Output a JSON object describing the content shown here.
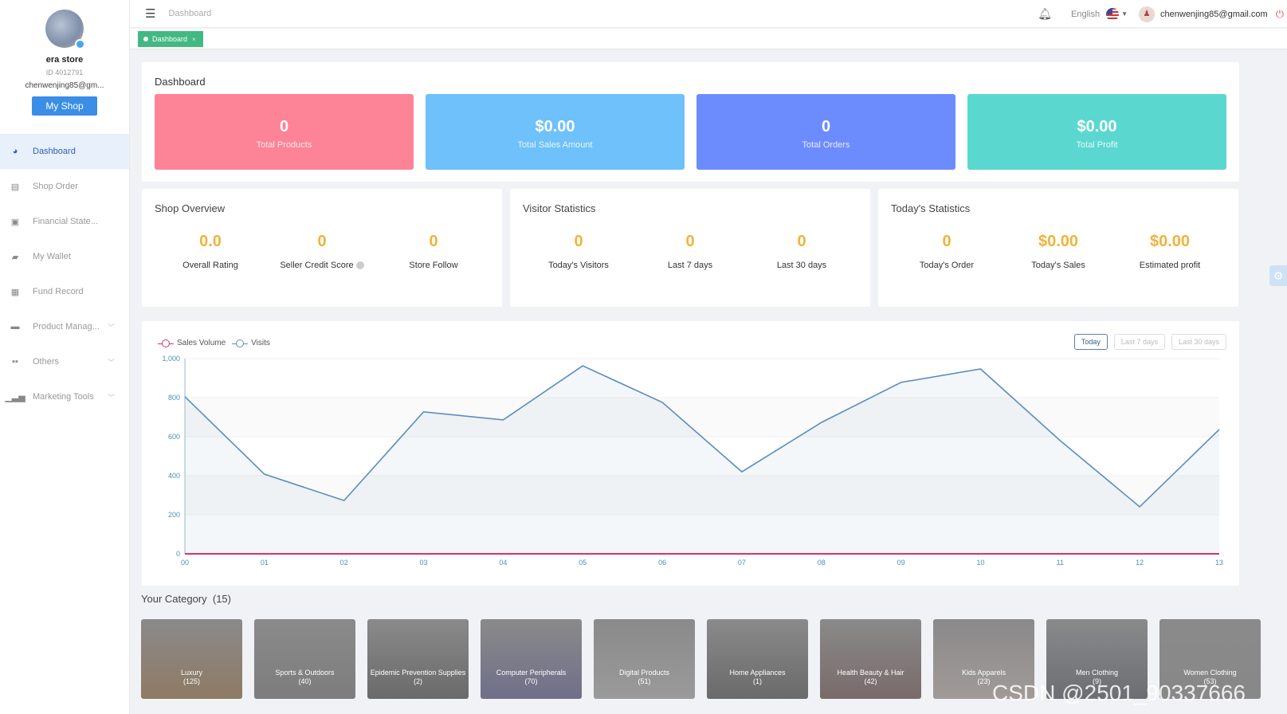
{
  "sidebar": {
    "store_name": "era store",
    "store_id": "ID 4012791",
    "email": "chenwenjing85@gm...",
    "my_shop": "My Shop",
    "items": [
      {
        "label": "Dashboard",
        "icon": "dashboard-icon",
        "active": true
      },
      {
        "label": "Shop Order",
        "icon": "clipboard-icon"
      },
      {
        "label": "Financial State...",
        "icon": "chart-box-icon"
      },
      {
        "label": "My Wallet",
        "icon": "wallet-icon"
      },
      {
        "label": "Fund Record",
        "icon": "document-icon"
      },
      {
        "label": "Product Manag...",
        "icon": "briefcase-icon",
        "expandable": true
      },
      {
        "label": "Others",
        "icon": "grid-icon",
        "expandable": true
      },
      {
        "label": "Marketing Tools",
        "icon": "bar-chart-icon",
        "expandable": true
      }
    ]
  },
  "topbar": {
    "breadcrumb": "Dashboard",
    "language": "English",
    "user_email": "chenwenjing85@gmail.com"
  },
  "tabs": [
    {
      "label": "Dashboard"
    }
  ],
  "dashboard": {
    "title": "Dashboard",
    "stats": [
      {
        "value": "0",
        "label": "Total Products",
        "color": "#fd8396"
      },
      {
        "value": "$0.00",
        "label": "Total Sales Amount",
        "color": "#6ec1fb"
      },
      {
        "value": "0",
        "label": "Total Orders",
        "color": "#6c8cfe"
      },
      {
        "value": "$0.00",
        "label": "Total Profit",
        "color": "#5ad8d0"
      }
    ]
  },
  "shop_overview": {
    "title": "Shop Overview",
    "metrics": [
      {
        "value": "0.0",
        "label": "Overall Rating"
      },
      {
        "value": "0",
        "label": "Seller Credit Score"
      },
      {
        "value": "0",
        "label": "Store Follow"
      }
    ]
  },
  "visitor_statistics": {
    "title": "Visitor Statistics",
    "metrics": [
      {
        "value": "0",
        "label": "Today's Visitors"
      },
      {
        "value": "0",
        "label": "Last 7 days"
      },
      {
        "value": "0",
        "label": "Last 30 days"
      }
    ]
  },
  "todays_statistics": {
    "title": "Today's Statistics",
    "metrics": [
      {
        "value": "0",
        "label": "Today's Order"
      },
      {
        "value": "$0.00",
        "label": "Today's Sales"
      },
      {
        "value": "$0.00",
        "label": "Estimated profit"
      }
    ]
  },
  "chart_controls": {
    "ranges": [
      "Today",
      "Last 7 days",
      "Last 30 days"
    ],
    "selected": "Today"
  },
  "chart_data": {
    "type": "line",
    "title": "",
    "xlabel": "",
    "ylabel": "",
    "x": [
      "00",
      "01",
      "02",
      "03",
      "04",
      "05",
      "06",
      "07",
      "08",
      "09",
      "10",
      "11",
      "12",
      "13"
    ],
    "ylim": [
      0,
      1000
    ],
    "yticks": [
      "0",
      "200",
      "400",
      "600",
      "800",
      "1,000"
    ],
    "grid": true,
    "legend": "top-left",
    "series": [
      {
        "name": "Sales Volume",
        "color": "#d6336c",
        "values": [
          0,
          0,
          0,
          0,
          0,
          0,
          0,
          0,
          0,
          0,
          0,
          0,
          0,
          0
        ]
      },
      {
        "name": "Visits",
        "color": "#5b8dbf",
        "area": true,
        "values": [
          805,
          408,
          273,
          727,
          686,
          963,
          776,
          420,
          673,
          878,
          947,
          580,
          241,
          637
        ]
      }
    ]
  },
  "categories": {
    "title": "Your Category",
    "count": "(15)",
    "items": [
      {
        "name": "Luxury",
        "count": "(125)"
      },
      {
        "name": "Sports & Outdoors",
        "count": "(40)"
      },
      {
        "name": "Epidemic Prevention Supplies",
        "count": "(2)"
      },
      {
        "name": "Computer Peripherals",
        "count": "(70)"
      },
      {
        "name": "Digital Products",
        "count": "(51)"
      },
      {
        "name": "Home Appliances",
        "count": "(1)"
      },
      {
        "name": "Health Beauty & Hair",
        "count": "(42)"
      },
      {
        "name": "Kids Apparels",
        "count": "(23)"
      },
      {
        "name": "Men Clothing",
        "count": "(9)"
      },
      {
        "name": "Women Clothing",
        "count": "(53)"
      }
    ]
  },
  "watermark": "CSDN @2501_90337666"
}
